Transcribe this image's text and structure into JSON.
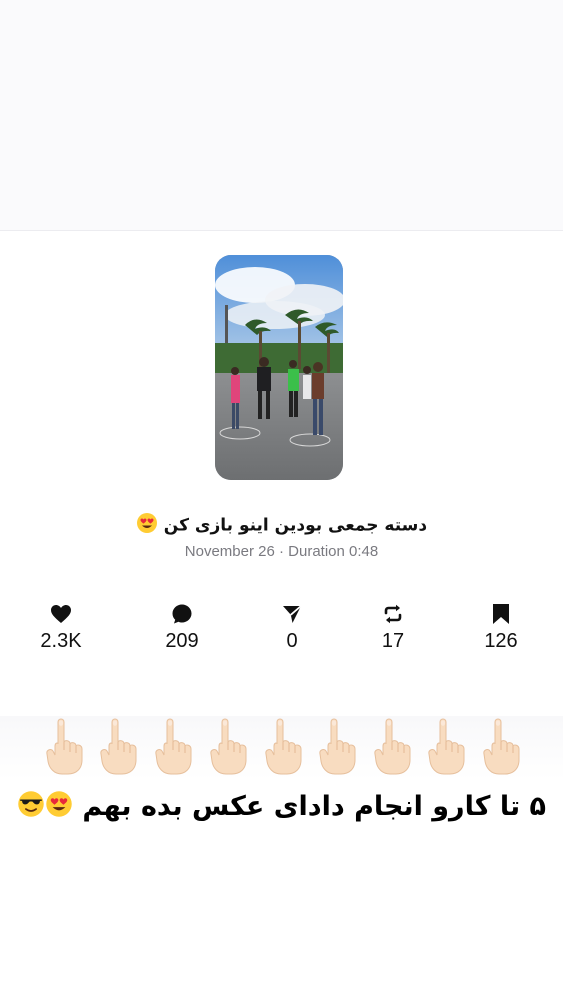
{
  "post": {
    "title": "دسته جمعی بودین اینو بازی کن",
    "title_emoji": "heart-eyes-emoji",
    "date": "November 26",
    "separator": "·",
    "duration": "Duration 0:48"
  },
  "stats": [
    {
      "icon": "heart-icon",
      "value": "2.3K"
    },
    {
      "icon": "comment-icon",
      "value": "209"
    },
    {
      "icon": "share-icon",
      "value": "0"
    },
    {
      "icon": "repost-icon",
      "value": "17"
    },
    {
      "icon": "bookmark-icon",
      "value": "126"
    }
  ],
  "overlay": {
    "pointing_emoji_count": 9,
    "caption": "۵ تا کارو انجام دادای عکس بده بهم",
    "caption_emojis": [
      "heart-eyes-emoji",
      "sunglasses-emoji"
    ]
  },
  "colors": {
    "text": "#111111",
    "muted": "#7a7a80",
    "top_bg": "#fafafc"
  }
}
